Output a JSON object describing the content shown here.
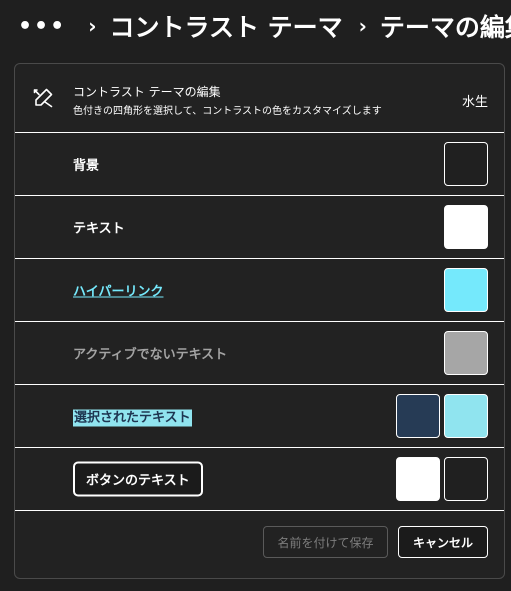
{
  "header": {
    "more": "•••",
    "crumb1": "コントラスト テーマ",
    "crumb2": "テーマの編集"
  },
  "panel": {
    "title": "コントラスト テーマの編集",
    "subtitle": "色付きの四角形を選択して、コントラストの色をカスタマイズします",
    "current_theme": "水生",
    "rows": [
      {
        "label": "背景",
        "colors": [
          "#202020"
        ]
      },
      {
        "label": "テキスト",
        "colors": [
          "#ffffff"
        ]
      },
      {
        "label": "ハイパーリンク",
        "colors": [
          "#75e9fc"
        ]
      },
      {
        "label": "アクティブでないテキスト",
        "colors": [
          "#a6a6a6"
        ]
      },
      {
        "label": "選択されたテキスト",
        "colors": [
          "#263b55",
          "#90e4ef"
        ]
      },
      {
        "label": "ボタンのテキスト",
        "colors": [
          "#ffffff",
          "#202020"
        ]
      }
    ]
  },
  "footer": {
    "save_label": "名前を付けて保存",
    "cancel_label": "キャンセル"
  }
}
